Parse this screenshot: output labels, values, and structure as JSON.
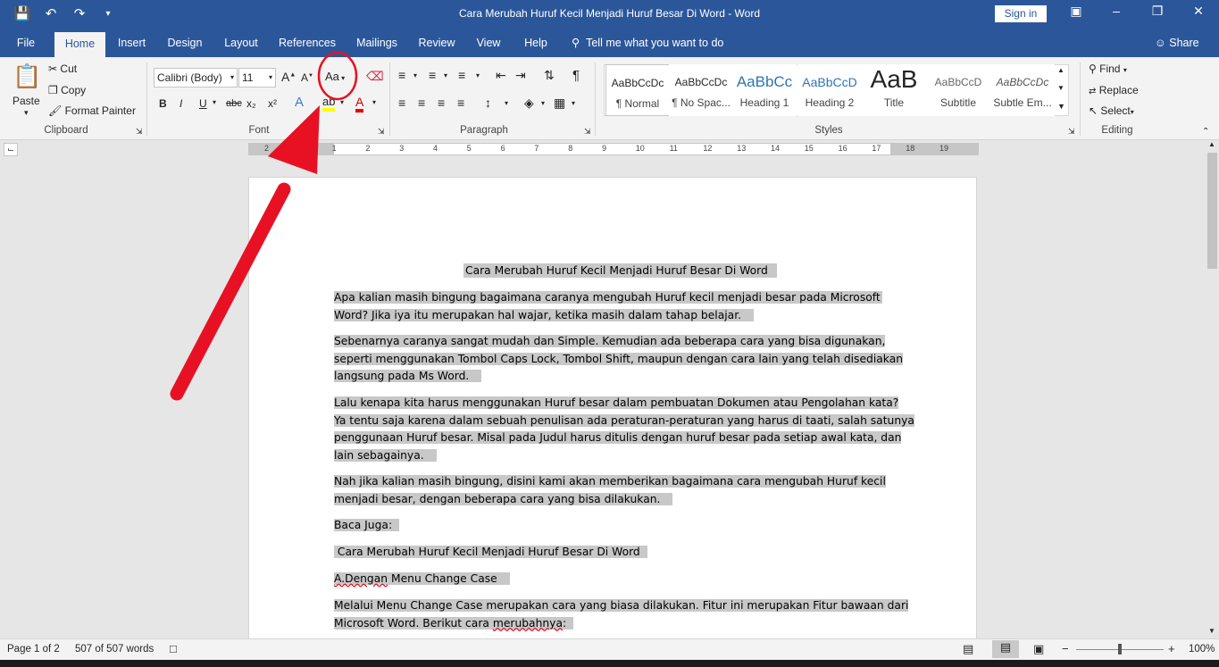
{
  "window": {
    "title": "Cara Merubah Huruf Kecil Menjadi Huruf Besar Di Word  -  Word",
    "sign_in": "Sign in"
  },
  "tabs": [
    "File",
    "Home",
    "Insert",
    "Design",
    "Layout",
    "References",
    "Mailings",
    "Review",
    "View",
    "Help"
  ],
  "tell_me": "Tell me what you want to do",
  "share": "Share",
  "clipboard": {
    "paste": "Paste",
    "cut": "Cut",
    "copy": "Copy",
    "format_painter": "Format Painter",
    "label": "Clipboard"
  },
  "font": {
    "name": "Calibri (Body)",
    "size": "11",
    "change_case": "Aa",
    "label": "Font",
    "bold": "B",
    "italic": "I",
    "underline": "U",
    "strike": "abc",
    "sub": "x₂",
    "sup": "x²"
  },
  "paragraph": {
    "label": "Paragraph"
  },
  "styles": {
    "label": "Styles",
    "items": [
      {
        "preview": "AaBbCcDc",
        "name": "¶ Normal"
      },
      {
        "preview": "AaBbCcDc",
        "name": "¶ No Spac..."
      },
      {
        "preview": "AaBbCc",
        "name": "Heading 1"
      },
      {
        "preview": "AaBbCcD",
        "name": "Heading 2"
      },
      {
        "preview": "AaB",
        "name": "Title"
      },
      {
        "preview": "AaBbCcD",
        "name": "Subtitle"
      },
      {
        "preview": "AaBbCcDc",
        "name": "Subtle Em..."
      }
    ]
  },
  "editing": {
    "label": "Editing",
    "find": "Find",
    "replace": "Replace",
    "select": "Select"
  },
  "ruler": [
    "2",
    "1",
    "1",
    "2",
    "3",
    "4",
    "5",
    "6",
    "7",
    "8",
    "9",
    "10",
    "11",
    "12",
    "13",
    "14",
    "15",
    "16",
    "17",
    "18",
    "19"
  ],
  "document": {
    "title": "Cara Merubah Huruf Kecil Menjadi Huruf Besar Di Word",
    "p1": [
      "Apa kalian masih bingung bagaimana caranya mengubah Huruf kecil menjadi besar pada Microsoft",
      "Word? Jika iya itu merupakan hal wajar, ketika masih dalam tahap belajar."
    ],
    "p2": [
      "Sebenarnya caranya sangat mudah dan Simple. Kemudian ada beberapa cara yang bisa digunakan,",
      "seperti menggunakan Tombol Caps Lock, Tombol Shift, maupun dengan cara lain yang telah disediakan",
      "langsung pada Ms Word."
    ],
    "p3": [
      "Lalu kenapa kita harus menggunakan Huruf besar dalam pembuatan Dokumen atau Pengolahan kata?",
      "Ya tentu saja karena dalam sebuah penulisan ada peraturan-peraturan yang harus di taati, salah satunya",
      "penggunaan Huruf besar. Misal pada Judul harus ditulis dengan huruf besar pada setiap awal kata, dan",
      "lain sebagainya."
    ],
    "p4": [
      "Nah jika kalian masih bingung, disini kami akan memberikan bagaimana cara mengubah Huruf kecil",
      "menjadi besar, dengan beberapa cara yang bisa dilakukan."
    ],
    "p5": "Baca Juga:",
    "p6": " Cara Merubah Huruf Kecil Menjadi Huruf Besar Di Word",
    "p7a": "A.Dengan",
    "p7b": " Menu Change Case",
    "p8a": "Melalui Menu Change Case merupakan cara yang biasa dilakukan. Fitur ini merupakan Fitur bawaan dari",
    "p8b": "Microsoft Word. Berikut cara ",
    "p8c": "merubahnya",
    "p8d": ":"
  },
  "status": {
    "page": "Page 1 of 2",
    "words": "507 of 507 words",
    "zoom": "100%"
  },
  "colors": {
    "accent": "#2b579a",
    "annotation": "#e81123",
    "highlight": "#c8c8c8"
  }
}
